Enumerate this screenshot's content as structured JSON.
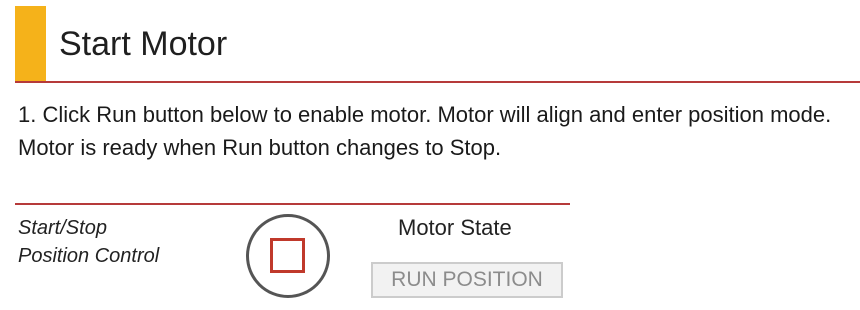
{
  "header": {
    "title": "Start Motor",
    "accent_color": "#f5b21a",
    "rule_color": "#b63a3a"
  },
  "instructions": {
    "text": "1. Click Run button below to enable motor. Motor will align and enter position mode. Motor is ready when Run button changes to Stop."
  },
  "control": {
    "label_line1": "Start/Stop",
    "label_line2": "Position Control",
    "button_icon": "stop-square-icon",
    "button_icon_color": "#c0392b"
  },
  "motor_state": {
    "label": "Motor State",
    "value": "RUN POSITION"
  }
}
